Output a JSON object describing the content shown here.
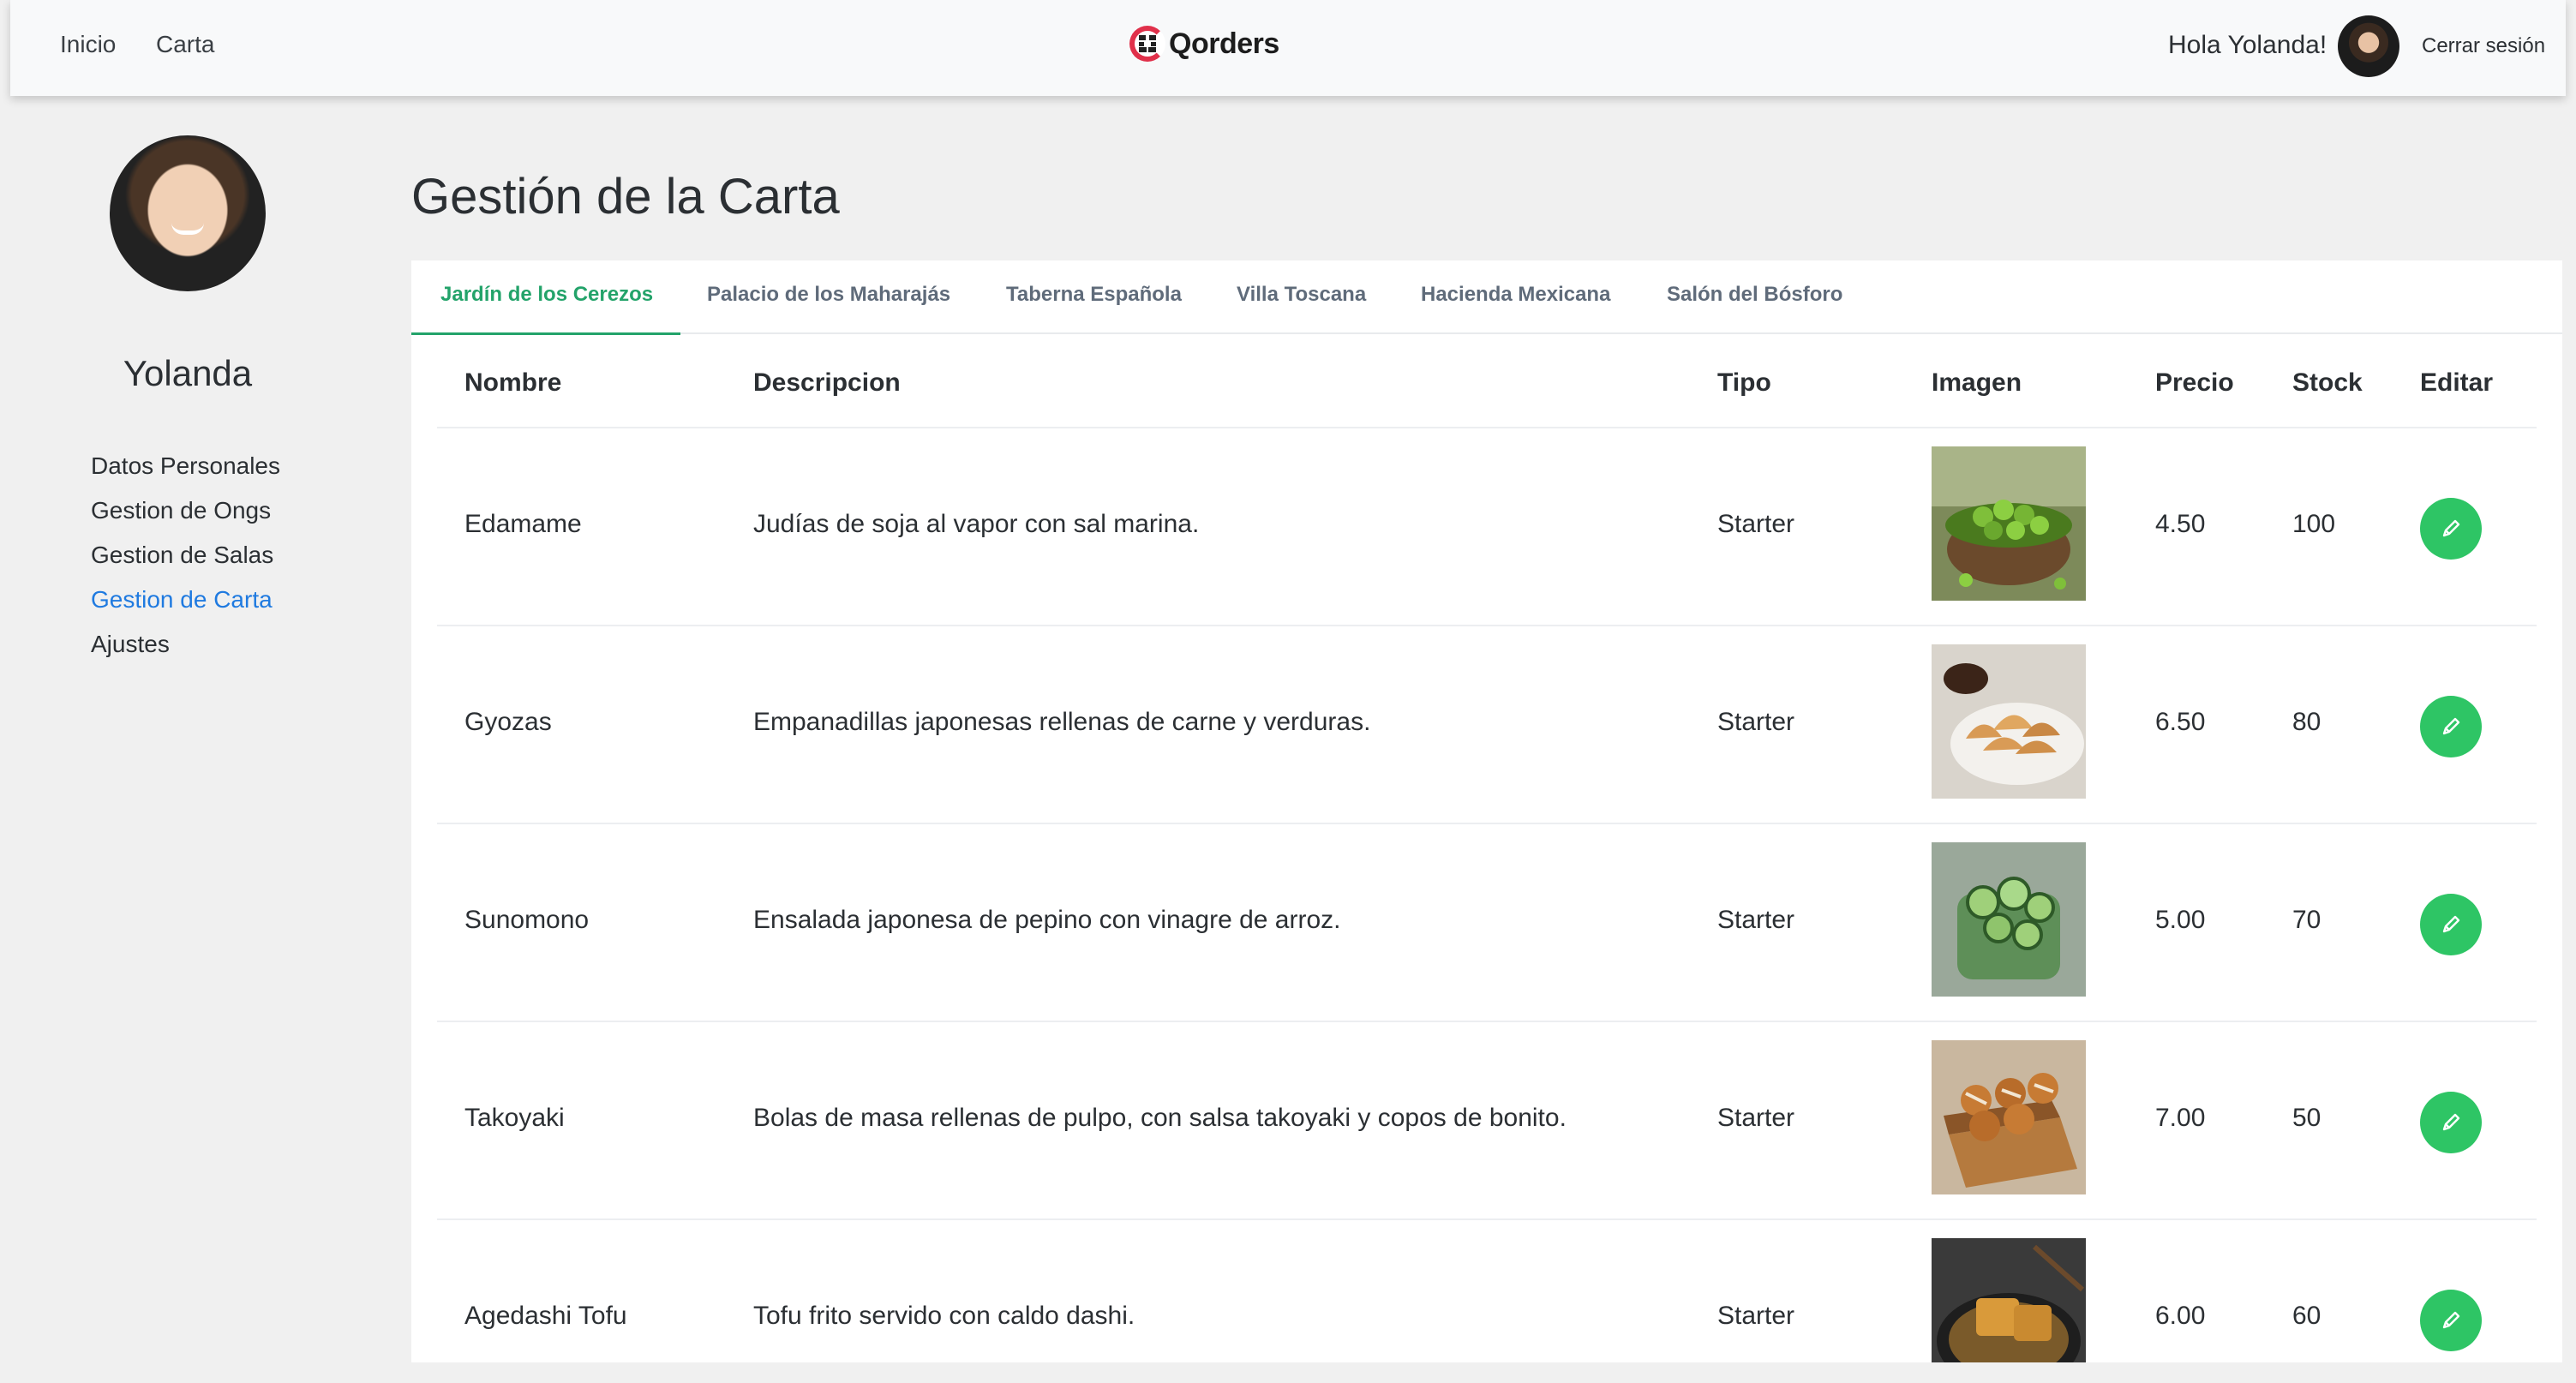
{
  "nav": {
    "links": [
      "Inicio",
      "Carta"
    ],
    "brand": "Qorders",
    "greeting": "Hola Yolanda!",
    "logout": "Cerrar sesión"
  },
  "sidebar": {
    "name": "Yolanda",
    "menu": [
      "Datos Personales",
      "Gestion de Ongs",
      "Gestion de Salas",
      "Gestion de Carta",
      "Ajustes"
    ],
    "active_index": 3
  },
  "page": {
    "title": "Gestión de la Carta"
  },
  "tabs": [
    "Jardín de los Cerezos",
    "Palacio de los Maharajás",
    "Taberna Española",
    "Villa Toscana",
    "Hacienda Mexicana",
    "Salón del Bósforo"
  ],
  "active_tab": 0,
  "table": {
    "headers": [
      "Nombre",
      "Descripcion",
      "Tipo",
      "Imagen",
      "Precio",
      "Stock",
      "Editar"
    ],
    "rows": [
      {
        "nombre": "Edamame",
        "descripcion": "Judías de soja al vapor con sal marina.",
        "tipo": "Starter",
        "precio": "4.50",
        "stock": "100",
        "image_icon": "edamame-image"
      },
      {
        "nombre": "Gyozas",
        "descripcion": "Empanadillas japonesas rellenas de carne y verduras.",
        "tipo": "Starter",
        "precio": "6.50",
        "stock": "80",
        "image_icon": "gyozas-image"
      },
      {
        "nombre": "Sunomono",
        "descripcion": "Ensalada japonesa de pepino con vinagre de arroz.",
        "tipo": "Starter",
        "precio": "5.00",
        "stock": "70",
        "image_icon": "sunomono-image"
      },
      {
        "nombre": "Takoyaki",
        "descripcion": "Bolas de masa rellenas de pulpo, con salsa takoyaki y copos de bonito.",
        "tipo": "Starter",
        "precio": "7.00",
        "stock": "50",
        "image_icon": "takoyaki-image"
      },
      {
        "nombre": "Agedashi Tofu",
        "descripcion": "Tofu frito servido con caldo dashi.",
        "tipo": "Starter",
        "precio": "6.00",
        "stock": "60",
        "image_icon": "agedashi-tofu-image"
      }
    ]
  },
  "colors": {
    "accent_green": "#2ec565",
    "tab_active": "#23a36a",
    "link_active": "#1f7ae0",
    "brand_red": "#e0304a"
  }
}
